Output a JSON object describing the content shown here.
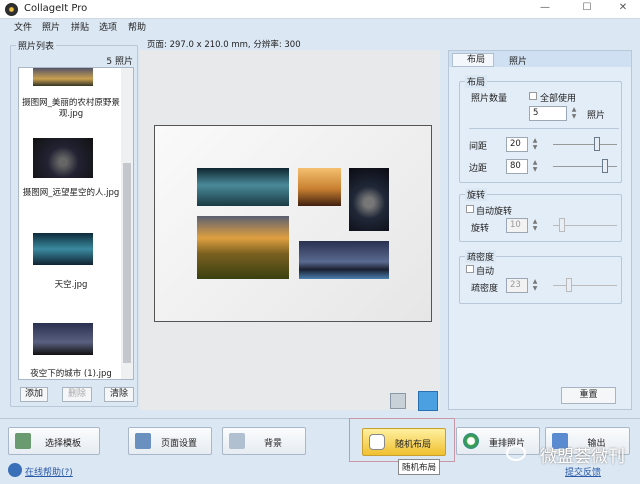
{
  "window": {
    "title": "CollageIt Pro",
    "controls": [
      "—",
      "☐",
      "✕"
    ]
  },
  "menu": [
    "文件",
    "照片",
    "拼贴",
    "选项",
    "帮助"
  ],
  "photo_list": {
    "label": "照片列表",
    "count": "5 照片",
    "items": [
      "摄图网_美丽的农村原野景观.jpg",
      "摄图网_远望星空的人.jpg",
      "天空.jpg",
      "夜空下的城市 (1).jpg"
    ],
    "buttons": {
      "add": "添加",
      "delete": "删除",
      "clear": "清除"
    }
  },
  "page_info": "页面: 297.0 x 210.0 mm, 分辨率: 300",
  "tabs": {
    "layout": "布局",
    "photos": "照片"
  },
  "layout": {
    "group": "布局",
    "photo_count_label": "照片数量",
    "use_all": "全部使用",
    "photo_count": "5",
    "photo_unit": "照片",
    "spacing_label": "间距",
    "spacing": "20",
    "spacing_slider_pct": 70,
    "margin_label": "边距",
    "margin": "80",
    "margin_slider_pct": 85
  },
  "rotation": {
    "group": "旋转",
    "auto": "自动旋转",
    "label": "旋转",
    "value": "10"
  },
  "sparsity": {
    "group": "疏密度",
    "auto": "自动",
    "label": "疏密度",
    "value": "23"
  },
  "reset": "重置",
  "toolbar": {
    "template": "选择模板",
    "page_setup": "页面设置",
    "background": "背景",
    "random_layout": "随机布局",
    "shuffle": "重排照片",
    "output": "输出"
  },
  "tooltip": "随机布局",
  "help_link": "在线帮助(?)",
  "feedback_link": "提交反馈",
  "watermark": "微盟荟微刊"
}
